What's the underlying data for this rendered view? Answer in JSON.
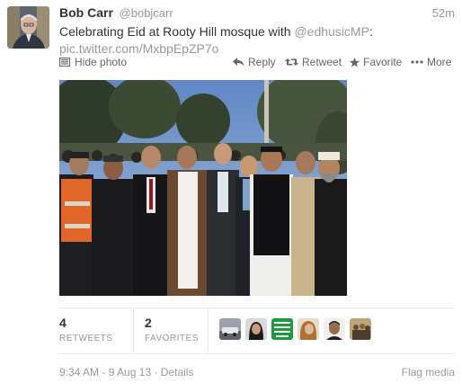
{
  "tweet": {
    "author": {
      "full_name": "Bob Carr",
      "handle": "@bobjcarr"
    },
    "time": "52m",
    "text": {
      "prefix": "Celebrating Eid at Rooty Hill mosque with ",
      "mention": "@edhusicMP",
      "suffix": ":",
      "link": "pic.twitter.com/MxbpEpZP7o"
    },
    "actions": {
      "hide_photo": "Hide photo",
      "reply": "Reply",
      "retweet": "Retweet",
      "favorite": "Favorite",
      "more": "More"
    },
    "stats": {
      "retweets_count": "4",
      "retweets_label": "RETWEETS",
      "favorites_count": "2",
      "favorites_label": "FAVORITES"
    },
    "favoriter_avatars": [
      {
        "icon": "car-photo-avatar",
        "color": "#8a8f99"
      },
      {
        "icon": "woman-portrait-avatar",
        "color": "#2b2b2b"
      },
      {
        "icon": "green-badge-avatar",
        "color": "#1c9b3c",
        "badge_text": "SEEKING ASYLUM IS A HUMAN RIGHT"
      },
      {
        "icon": "woman-hair-avatar",
        "color": "#c58a4a"
      },
      {
        "icon": "man-portrait-avatar",
        "color": "#4a3a32"
      },
      {
        "icon": "group-photo-avatar",
        "color": "#7a6a4a"
      }
    ],
    "footer": {
      "timestamp": "9:34 AM - 9 Aug 13",
      "separator": "·",
      "details": "Details",
      "flag_media": "Flag media"
    }
  },
  "colors": {
    "text": "#333333",
    "muted": "#999999",
    "action": "#666666",
    "divider": "#e8e8e8"
  }
}
